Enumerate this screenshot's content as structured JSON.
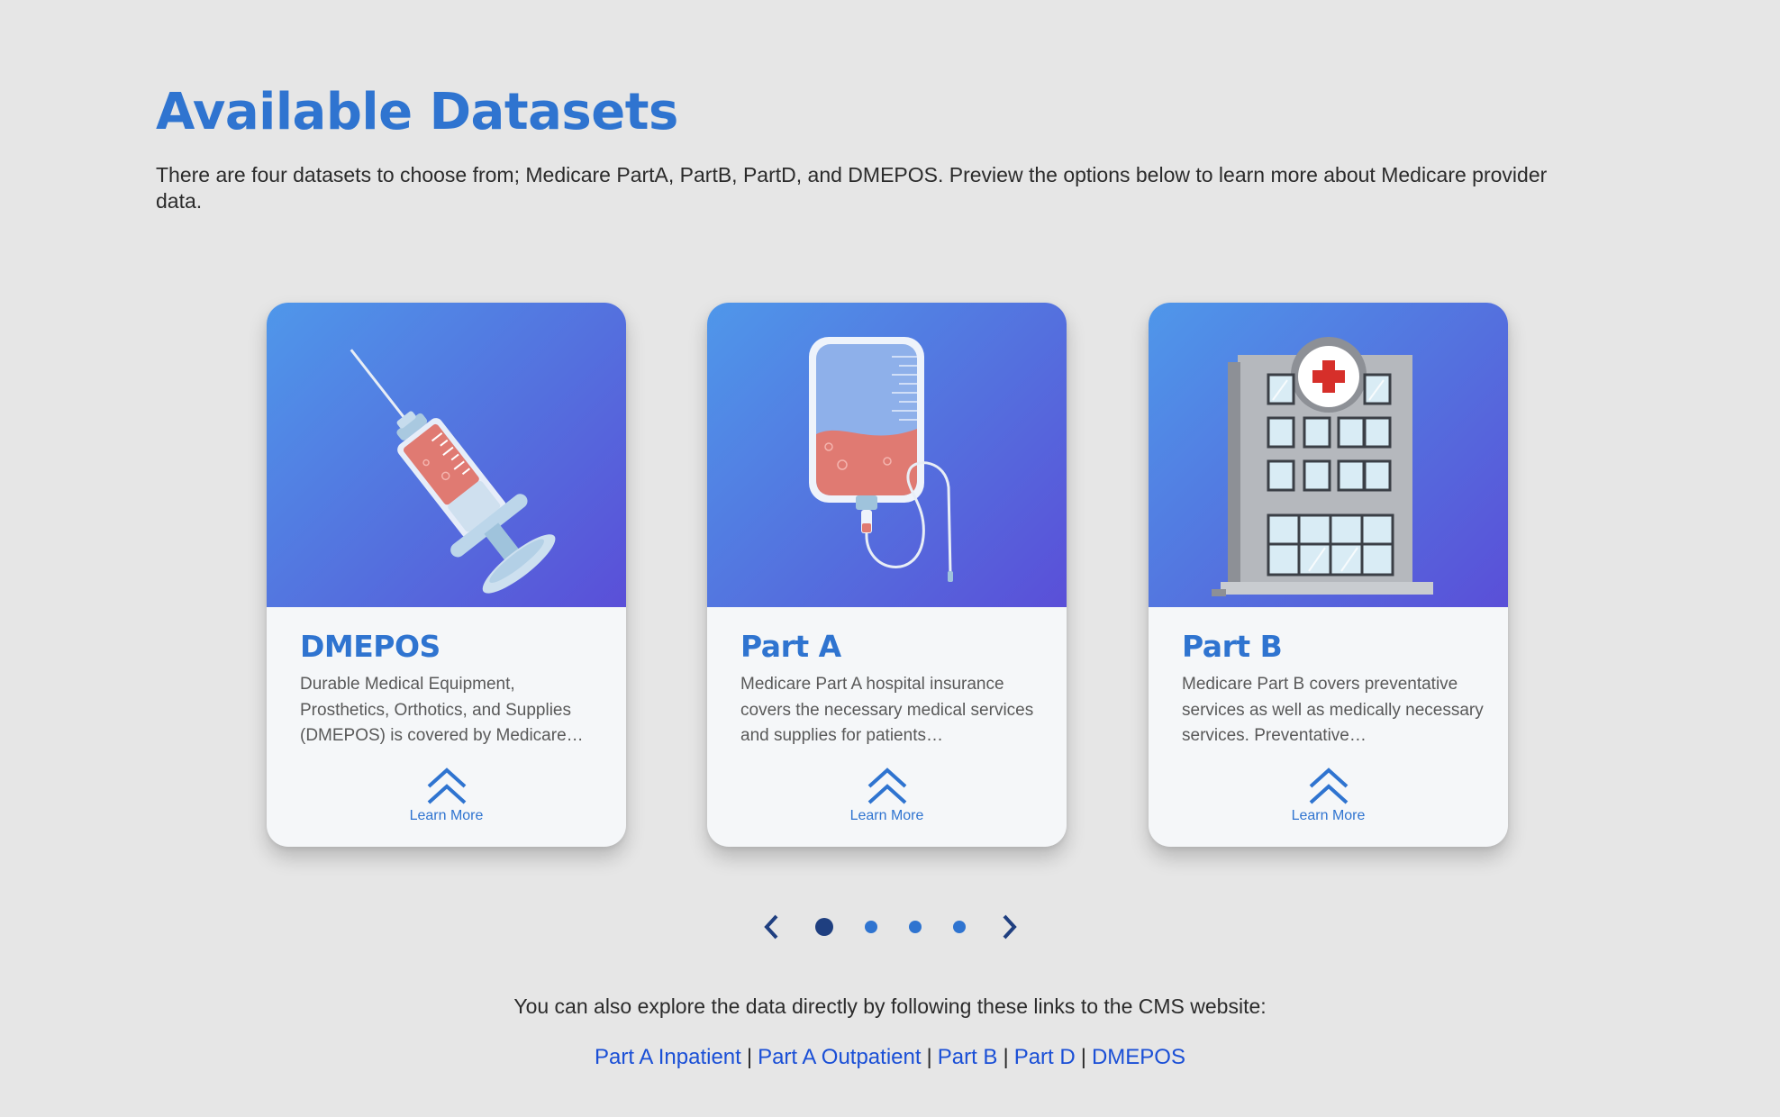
{
  "page": {
    "title": "Available Datasets",
    "intro": "There are four datasets to choose from; Medicare PartA, PartB, PartD, and DMEPOS. Preview the options below to learn more about Medicare provider data."
  },
  "cards": [
    {
      "title": "DMEPOS",
      "description": "Durable Medical Equipment, Prosthetics, Orthotics, and Supplies (DMEPOS) is covered by Medicare…",
      "learn_more": "Learn More",
      "icon": "syringe-icon"
    },
    {
      "title": "Part A",
      "description": "Medicare Part A hospital insurance covers the necessary medical services and supplies for patients…",
      "learn_more": "Learn More",
      "icon": "iv-bag-icon"
    },
    {
      "title": "Part B",
      "description": "Medicare Part B covers preventative services as well as medically necessary services. Preventative…",
      "learn_more": "Learn More",
      "icon": "hospital-icon"
    }
  ],
  "carousel": {
    "dots": 4,
    "active_index": 0
  },
  "footer": {
    "explore_text": "You can also explore the data directly by following these links to the CMS website:",
    "links": [
      "Part A Inpatient",
      "Part A Outpatient",
      "Part B",
      "Part D",
      "DMEPOS"
    ],
    "separator": "|"
  },
  "colors": {
    "accent": "#2f74d0",
    "link": "#1a4fd6",
    "active_dot": "#1f3f80",
    "background": "#e6e6e6"
  }
}
